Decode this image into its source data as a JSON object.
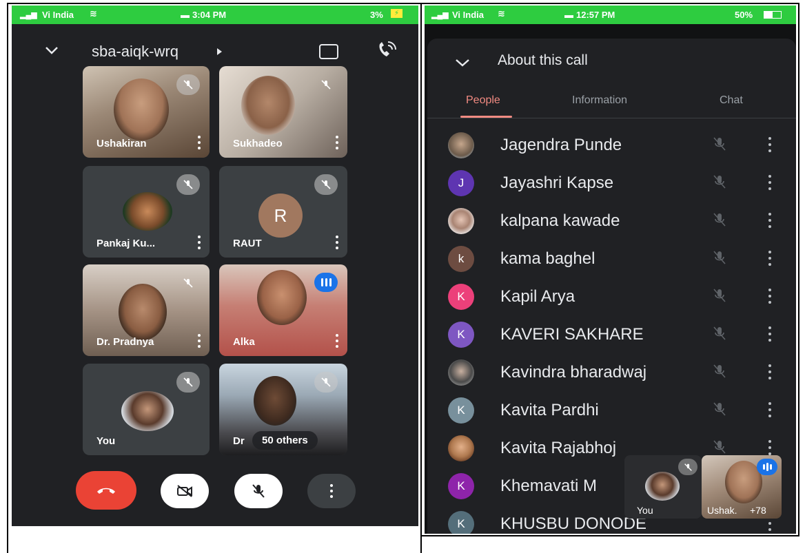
{
  "left": {
    "status": {
      "carrier": "Vi India",
      "time": "3:04 PM",
      "battery": "3%"
    },
    "meeting_code": "sba-aiqk-wrq",
    "tiles": [
      {
        "name": "Ushakiran",
        "kind": "video",
        "bg": "#6b5a4a"
      },
      {
        "name": "Sukhadeo",
        "kind": "video",
        "bg": "#8a7e74"
      },
      {
        "name": "Pankaj Ku...",
        "kind": "avatar-photo"
      },
      {
        "name": "RAUT",
        "kind": "letter",
        "letter": "R",
        "color": "#a1785f"
      },
      {
        "name": "Dr. Pradnya",
        "kind": "video",
        "bg": "#9c8a7a"
      },
      {
        "name": "Alka",
        "kind": "video",
        "bg": "#b36b63",
        "speaking": true
      },
      {
        "name": "You",
        "kind": "avatar-photo"
      },
      {
        "name": "Dr",
        "kind": "video",
        "bg": "#8fa0b0",
        "others_label": "50 others"
      }
    ],
    "colors": {
      "end_call": "#ea4335",
      "speaking": "#1a73e8"
    }
  },
  "right": {
    "status": {
      "carrier": "Vi India",
      "time": "12:57 PM",
      "battery": "50%"
    },
    "panel_title": "About this call",
    "tabs": [
      "People",
      "Information",
      "Chat"
    ],
    "active_tab": "People",
    "people": [
      {
        "name": "Jagendra Punde",
        "avatar": "photo",
        "color": "#7a6a5a"
      },
      {
        "name": "Jayashri Kapse",
        "avatar": "letter",
        "letter": "J",
        "color": "#5e35b1"
      },
      {
        "name": "kalpana kawade",
        "avatar": "photo",
        "color": "#c9a89a"
      },
      {
        "name": "kama baghel",
        "avatar": "letter",
        "letter": "k",
        "color": "#6d4c41"
      },
      {
        "name": "Kapil Arya",
        "avatar": "letter",
        "letter": "K",
        "color": "#ec407a"
      },
      {
        "name": "KAVERI SAKHARE",
        "avatar": "letter",
        "letter": "K",
        "color": "#7e57c2"
      },
      {
        "name": "Kavindra bharadwaj",
        "avatar": "photo",
        "color": "#5a5a5a"
      },
      {
        "name": "Kavita Pardhi",
        "avatar": "letter",
        "letter": "K",
        "color": "#78909c"
      },
      {
        "name": "Kavita Rajabhoj",
        "avatar": "photo",
        "color": "#b07a50"
      },
      {
        "name": "Khemavati M",
        "avatar": "letter",
        "letter": "K",
        "color": "#8e24aa"
      },
      {
        "name": "KHUSBU DONODE",
        "avatar": "letter",
        "letter": "K",
        "color": "#546e7a"
      }
    ],
    "pip": {
      "you_label": "You",
      "other_label": "Ushak.",
      "more_label": "+78"
    }
  }
}
